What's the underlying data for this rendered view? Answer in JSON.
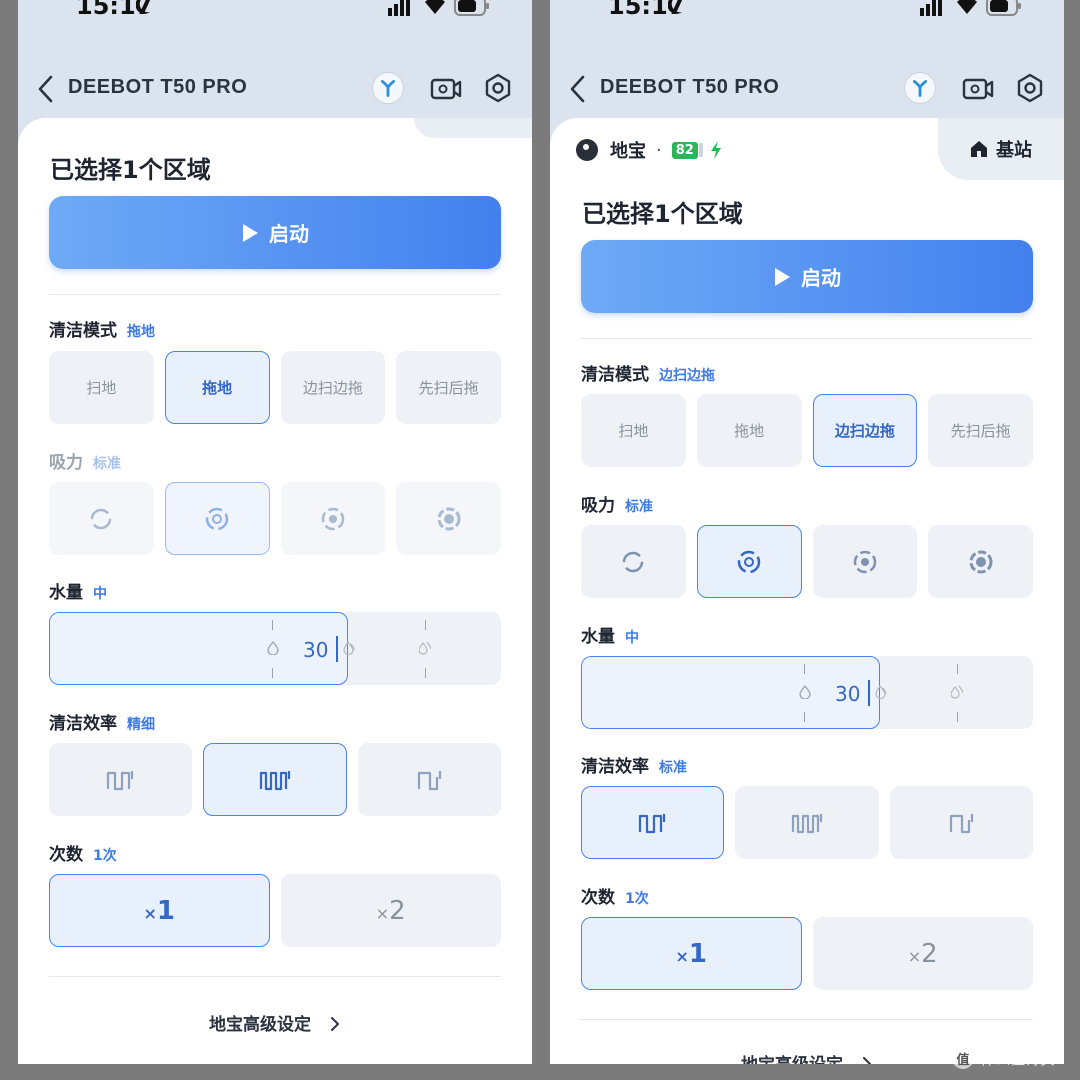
{
  "status_bar": {
    "time": "15:17"
  },
  "nav": {
    "title": "DEEBOT T50 PRO"
  },
  "left": {
    "selected_title": "已选择1个区域",
    "start_label": "启动",
    "clean_mode": {
      "label": "清洁模式",
      "value": "拖地",
      "options": [
        "扫地",
        "拖地",
        "边扫边拖",
        "先扫后拖"
      ],
      "selected": 1
    },
    "suction": {
      "label": "吸力",
      "value": "标准",
      "selected": 1,
      "icons": [
        "fan-quiet-icon",
        "fan-standard-icon",
        "fan-strong-icon",
        "fan-max-icon"
      ]
    },
    "water": {
      "label": "水量",
      "value": "中",
      "slider_value": "30"
    },
    "efficiency": {
      "label": "清洁效率",
      "value": "精细",
      "selected": 1,
      "icons": [
        "wave-standard-icon",
        "wave-fine-icon",
        "wave-quick-icon"
      ]
    },
    "times": {
      "label": "次数",
      "value": "1次",
      "options": [
        {
          "prefix": "×",
          "num": "1"
        },
        {
          "prefix": "×",
          "num": "2"
        }
      ],
      "selected": 0
    },
    "advanced": "地宝高级设定"
  },
  "right": {
    "robot_name": "地宝",
    "battery": "82",
    "base_label": "基站",
    "selected_title": "已选择1个区域",
    "start_label": "启动",
    "clean_mode": {
      "label": "清洁模式",
      "value": "边扫边拖",
      "options": [
        "扫地",
        "拖地",
        "边扫边拖",
        "先扫后拖"
      ],
      "selected": 2
    },
    "suction": {
      "label": "吸力",
      "value": "标准",
      "selected": 1
    },
    "water": {
      "label": "水量",
      "value": "中",
      "slider_value": "30"
    },
    "efficiency": {
      "label": "清洁效率",
      "value": "标准",
      "selected": 0
    },
    "times": {
      "label": "次数",
      "value": "1次",
      "options": [
        {
          "prefix": "×",
          "num": "1"
        },
        {
          "prefix": "×",
          "num": "2"
        }
      ],
      "selected": 0
    },
    "advanced": "地宝高级设定"
  },
  "watermark": {
    "logo": "值",
    "text": "什么值得买"
  },
  "colors": {
    "accent": "#4380ee",
    "battery_green": "#2fb457",
    "selected_border": "#4a84e8"
  }
}
